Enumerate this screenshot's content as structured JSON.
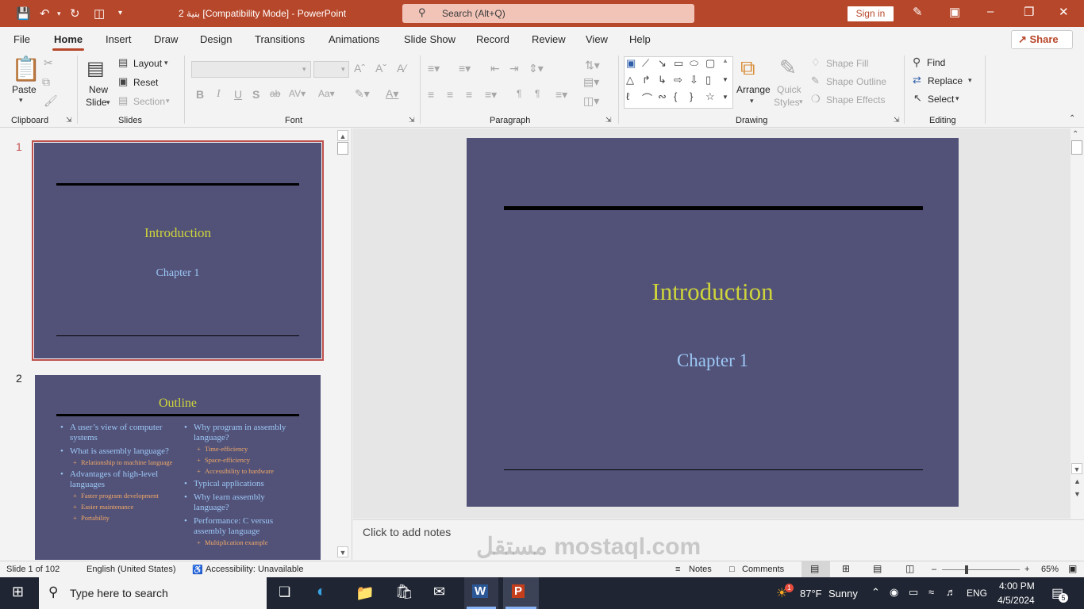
{
  "titlebar": {
    "doc_title": "بنية 2 [Compatibility Mode]  -  PowerPoint",
    "search_placeholder": "Search (Alt+Q)",
    "signin_label": "Sign in"
  },
  "menu": {
    "tabs": [
      "File",
      "Home",
      "Insert",
      "Draw",
      "Design",
      "Transitions",
      "Animations",
      "Slide Show",
      "Record",
      "Review",
      "View",
      "Help"
    ],
    "active_tab": "Home",
    "share_label": "Share"
  },
  "ribbon": {
    "clipboard": {
      "paste": "Paste",
      "group": "Clipboard"
    },
    "slides": {
      "new_slide_1": "New",
      "new_slide_2": "Slide",
      "layout": "Layout",
      "reset": "Reset",
      "section": "Section",
      "group": "Slides"
    },
    "font": {
      "bold": "B",
      "italic": "I",
      "underline": "U",
      "shadow": "S",
      "strike": "ab",
      "group": "Font"
    },
    "paragraph": {
      "group": "Paragraph"
    },
    "drawing": {
      "arrange": "Arrange",
      "quick_styles_1": "Quick",
      "quick_styles_2": "Styles",
      "shape_fill": "Shape Fill",
      "shape_outline": "Shape Outline",
      "shape_effects": "Shape Effects",
      "group": "Drawing"
    },
    "editing": {
      "find": "Find",
      "replace": "Replace",
      "select": "Select",
      "group": "Editing"
    }
  },
  "thumbnails": [
    {
      "number": "1",
      "title": "Introduction",
      "subtitle": "Chapter 1"
    },
    {
      "number": "2",
      "title": "Outline",
      "col1": [
        {
          "level": 1,
          "text": "A user’s view of computer systems"
        },
        {
          "level": 1,
          "text": "What is assembly language?"
        },
        {
          "level": 2,
          "text": "Relationship to machine language"
        },
        {
          "level": 1,
          "text": "Advantages of high-level languages"
        },
        {
          "level": 2,
          "text": "Faster program development"
        },
        {
          "level": 2,
          "text": "Easier maintenance"
        },
        {
          "level": 2,
          "text": "Portability"
        }
      ],
      "col2": [
        {
          "level": 1,
          "text": "Why program in assembly language?"
        },
        {
          "level": 2,
          "text": "Time-efficiency"
        },
        {
          "level": 2,
          "text": "Space-efficiency"
        },
        {
          "level": 2,
          "text": "Accessibility to hardware"
        },
        {
          "level": 1,
          "text": "Typical applications"
        },
        {
          "level": 1,
          "text": "Why learn assembly language?"
        },
        {
          "level": 1,
          "text": "Performance: C versus assembly language"
        },
        {
          "level": 2,
          "text": "Multiplication example"
        }
      ]
    }
  ],
  "main_slide": {
    "title": "Introduction",
    "subtitle": "Chapter 1"
  },
  "notes": {
    "placeholder": "Click to add notes"
  },
  "status": {
    "slide_count": "Slide 1 of 102",
    "language": "English (United States)",
    "accessibility": "Accessibility: Unavailable",
    "notes": "Notes",
    "comments": "Comments",
    "zoom": "65%"
  },
  "taskbar": {
    "search_placeholder": "Type here to search",
    "weather_temp": "87°F",
    "weather_text": "Sunny",
    "weather_badge": "1",
    "lang": "ENG",
    "time": "4:00 PM",
    "date": "4/5/2024",
    "notif_count": "5"
  },
  "colors": {
    "accent": "#b7472a",
    "slide_bg": "#525279",
    "title_color": "#cfd53a",
    "subtitle_color": "#9cc8f5"
  },
  "watermark": "مستقل mostaql.com"
}
